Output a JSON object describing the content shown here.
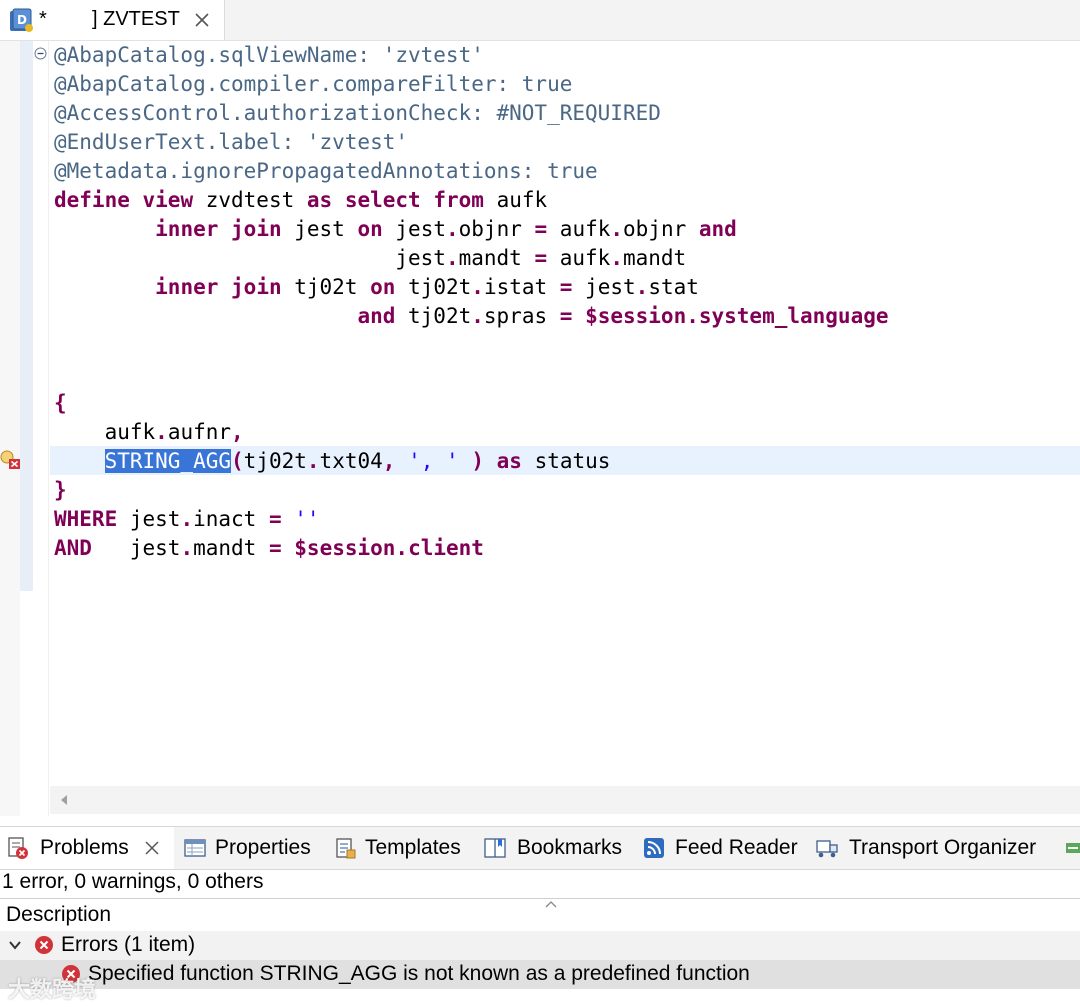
{
  "tab": {
    "dirty_marker": "*",
    "title": "] ZVTEST"
  },
  "code_lines": [
    [
      {
        "t": "@AbapCatalog.sqlViewName: 'zvtest'",
        "c": "ann"
      }
    ],
    [
      {
        "t": "@AbapCatalog.compiler.compareFilter: true",
        "c": "ann"
      }
    ],
    [
      {
        "t": "@AccessControl.authorizationCheck: #NOT_REQUIRED",
        "c": "ann"
      }
    ],
    [
      {
        "t": "@EndUserText.label: 'zvtest'",
        "c": "ann"
      }
    ],
    [
      {
        "t": "@Metadata.ignorePropagatedAnnotations: true",
        "c": "ann"
      }
    ],
    [
      {
        "t": "define",
        "c": "kw"
      },
      {
        "t": " "
      },
      {
        "t": "view",
        "c": "kw"
      },
      {
        "t": " zvdtest "
      },
      {
        "t": "as",
        "c": "kw"
      },
      {
        "t": " "
      },
      {
        "t": "select",
        "c": "kw"
      },
      {
        "t": " "
      },
      {
        "t": "from",
        "c": "kw"
      },
      {
        "t": " aufk"
      }
    ],
    [
      {
        "t": "        "
      },
      {
        "t": "inner",
        "c": "kw"
      },
      {
        "t": " "
      },
      {
        "t": "join",
        "c": "kw"
      },
      {
        "t": " jest "
      },
      {
        "t": "on",
        "c": "kw"
      },
      {
        "t": " jest"
      },
      {
        "t": ".",
        "c": "kw"
      },
      {
        "t": "objnr "
      },
      {
        "t": "=",
        "c": "kw"
      },
      {
        "t": " aufk"
      },
      {
        "t": ".",
        "c": "kw"
      },
      {
        "t": "objnr "
      },
      {
        "t": "and",
        "c": "kw"
      }
    ],
    [
      {
        "t": "                           jest"
      },
      {
        "t": ".",
        "c": "kw"
      },
      {
        "t": "mandt "
      },
      {
        "t": "=",
        "c": "kw"
      },
      {
        "t": " aufk"
      },
      {
        "t": ".",
        "c": "kw"
      },
      {
        "t": "mandt"
      }
    ],
    [
      {
        "t": "        "
      },
      {
        "t": "inner",
        "c": "kw"
      },
      {
        "t": " "
      },
      {
        "t": "join",
        "c": "kw"
      },
      {
        "t": " tj02t "
      },
      {
        "t": "on",
        "c": "kw"
      },
      {
        "t": " tj02t"
      },
      {
        "t": ".",
        "c": "kw"
      },
      {
        "t": "istat "
      },
      {
        "t": "=",
        "c": "kw"
      },
      {
        "t": " jest"
      },
      {
        "t": ".",
        "c": "kw"
      },
      {
        "t": "stat"
      }
    ],
    [
      {
        "t": "                        "
      },
      {
        "t": "and",
        "c": "kw"
      },
      {
        "t": " tj02t"
      },
      {
        "t": ".",
        "c": "kw"
      },
      {
        "t": "spras "
      },
      {
        "t": "=",
        "c": "kw"
      },
      {
        "t": " "
      },
      {
        "t": "$session.system_language",
        "c": "kw"
      }
    ],
    [
      {
        "t": ""
      }
    ],
    [
      {
        "t": ""
      }
    ],
    [
      {
        "t": "{",
        "c": "kw"
      }
    ],
    [
      {
        "t": "    aufk"
      },
      {
        "t": ".",
        "c": "kw"
      },
      {
        "t": "aufnr"
      },
      {
        "t": ",",
        "c": "kw"
      }
    ],
    [
      {
        "t": "    "
      },
      {
        "t": "STRING_AGG",
        "c": "sel"
      },
      {
        "t": "(",
        "c": "kw"
      },
      {
        "t": "tj02t"
      },
      {
        "t": ".",
        "c": "kw"
      },
      {
        "t": "txt04"
      },
      {
        "t": ",",
        "c": "kw"
      },
      {
        "t": " "
      },
      {
        "t": "', '",
        "c": "str"
      },
      {
        "t": " "
      },
      {
        "t": ")",
        "c": "kw"
      },
      {
        "t": " "
      },
      {
        "t": "as",
        "c": "kw"
      },
      {
        "t": " status"
      }
    ],
    [
      {
        "t": "}",
        "c": "kw"
      }
    ],
    [
      {
        "t": "WHERE",
        "c": "kw"
      },
      {
        "t": " jest"
      },
      {
        "t": ".",
        "c": "kw"
      },
      {
        "t": "inact "
      },
      {
        "t": "=",
        "c": "kw"
      },
      {
        "t": " "
      },
      {
        "t": "''",
        "c": "str"
      }
    ],
    [
      {
        "t": "AND",
        "c": "kw"
      },
      {
        "t": "   jest"
      },
      {
        "t": ".",
        "c": "kw"
      },
      {
        "t": "mandt "
      },
      {
        "t": "=",
        "c": "kw"
      },
      {
        "t": " "
      },
      {
        "t": "$session.client",
        "c": "kw"
      }
    ]
  ],
  "view_tabs": [
    {
      "label": "Problems",
      "icon": "problems-icon",
      "closable": true
    },
    {
      "label": "Properties",
      "icon": "properties-icon"
    },
    {
      "label": "Templates",
      "icon": "templates-icon"
    },
    {
      "label": "Bookmarks",
      "icon": "bookmarks-icon"
    },
    {
      "label": "Feed Reader",
      "icon": "feed-reader-icon"
    },
    {
      "label": "Transport Organizer",
      "icon": "transport-organizer-icon"
    }
  ],
  "problems": {
    "summary": "1 error, 0 warnings, 0 others",
    "column_header": "Description",
    "group_label": "Errors (1 item)",
    "error_message": "Specified function STRING_AGG is not known as a predefined function"
  },
  "watermark": "大数跨境",
  "colors": {
    "keyword": "#7f0055",
    "annotation": "#4a6785",
    "string": "#2a00ff",
    "selection": "#3875d7",
    "current_line": "#e8f2fe",
    "error": "#d0343a"
  }
}
